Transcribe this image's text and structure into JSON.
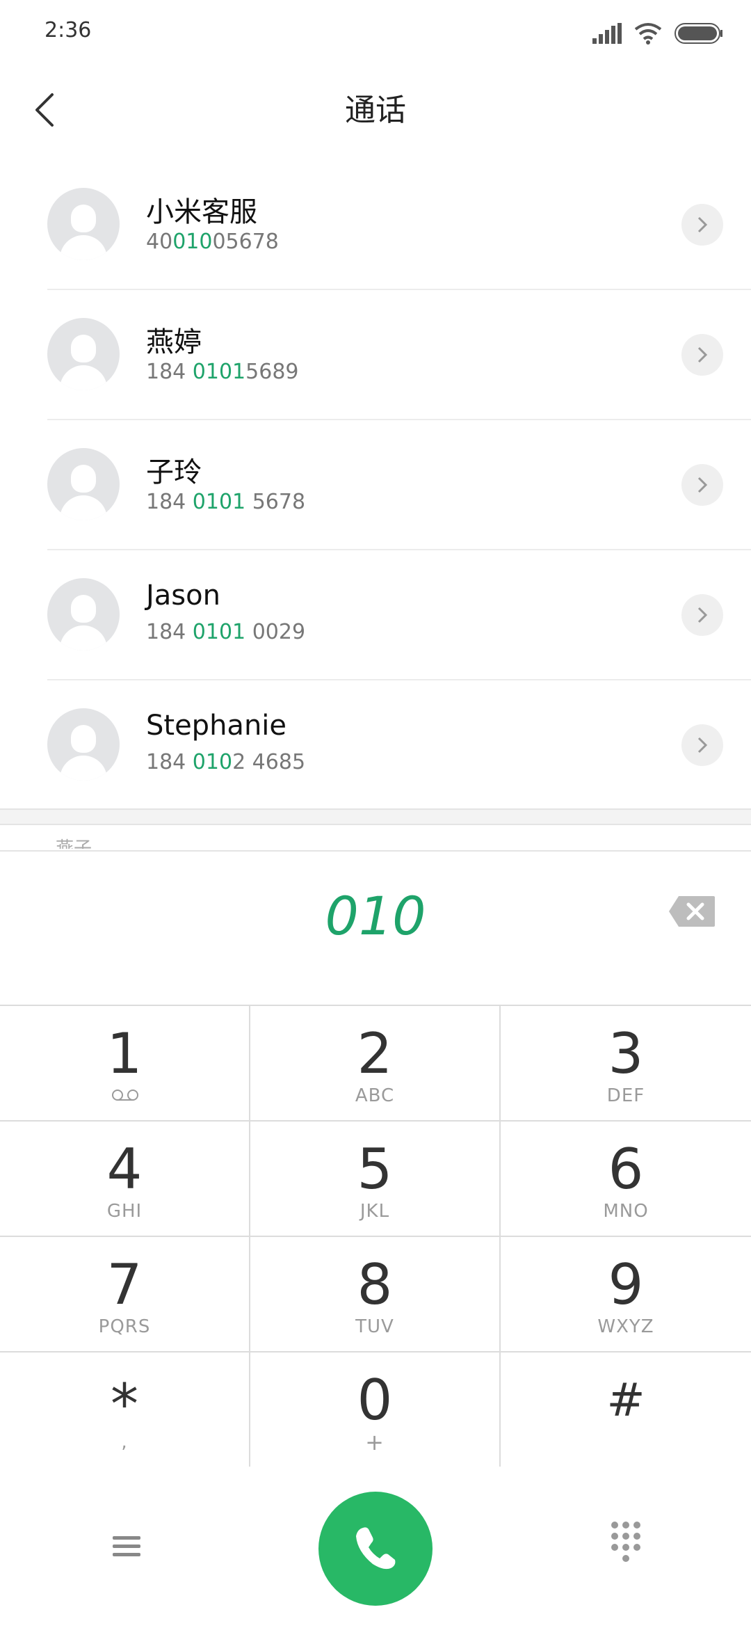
{
  "status": {
    "time": "2:36"
  },
  "header": {
    "title": "通话"
  },
  "contacts": [
    {
      "name": "小米客服",
      "num_pre": "40",
      "num_hl": "010",
      "num_post": "05678"
    },
    {
      "name": "燕婷",
      "num_pre": "184 ",
      "num_hl": "0101",
      "num_post": "5689"
    },
    {
      "name": "子玲",
      "num_pre": "184 ",
      "num_hl": "0101",
      "num_post": " 5678"
    },
    {
      "name": "Jason",
      "num_pre": "184 ",
      "num_hl": "0101",
      "num_post": " 0029"
    },
    {
      "name": "Stephanie",
      "num_pre": "184 ",
      "num_hl": "010",
      "num_post": "2 4685"
    }
  ],
  "peek_text": "燕子",
  "dialer": {
    "number": "010"
  },
  "keypad": [
    {
      "digit": "1",
      "letters": ""
    },
    {
      "digit": "2",
      "letters": "ABC"
    },
    {
      "digit": "3",
      "letters": "DEF"
    },
    {
      "digit": "4",
      "letters": "GHI"
    },
    {
      "digit": "5",
      "letters": "JKL"
    },
    {
      "digit": "6",
      "letters": "MNO"
    },
    {
      "digit": "7",
      "letters": "PQRS"
    },
    {
      "digit": "8",
      "letters": "TUV"
    },
    {
      "digit": "9",
      "letters": "WXYZ"
    },
    {
      "digit": "*",
      "letters": ","
    },
    {
      "digit": "0",
      "letters": "+"
    },
    {
      "digit": "#",
      "letters": ""
    }
  ],
  "colors": {
    "accent": "#1ea36a",
    "call_button": "#28b866"
  },
  "icons": [
    "signal-icon",
    "wifi-icon",
    "battery-icon",
    "back-arrow-icon",
    "chevron-right-icon",
    "backspace-icon",
    "voicemail-icon",
    "menu-icon",
    "phone-icon",
    "dialpad-icon"
  ]
}
